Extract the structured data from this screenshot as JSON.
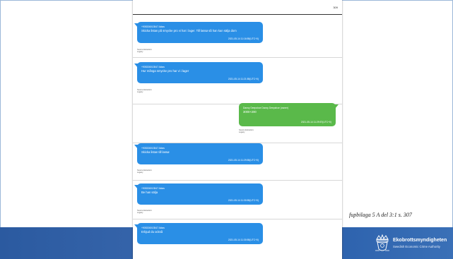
{
  "page": {
    "number": "309"
  },
  "messages": [
    {
      "sender": "+905336013547 Aktas",
      "body": "Skicka listan på smycke pro vi har i lager. Till lassø så han kan sälja dom",
      "timestamp": "2021-05-14 11:16:55(UTC+0)",
      "meta": [
        "Source Extraction:",
        "Legacy"
      ]
    },
    {
      "sender": "+905336013547 Aktas",
      "body": "Hur många smycke pro har vi i lager",
      "timestamp": "2021-05-14 11:21:55(UTC+0)",
      "meta": [
        "Source Extraction:",
        "Legacy"
      ]
    },
    {
      "sender": "Danny Deepshoe Danny Deepshoe (owner)",
      "body": "3000+200",
      "timestamp": "2021-05-14 11:29:57(UTC+0)",
      "meta": [
        "Source Extraction:",
        "Legacy"
      ]
    },
    {
      "sender": "+905336013547 Aktas",
      "body": "Skicka listan till lassø",
      "timestamp": "2021-05-14 11:29:55(UTC+0)",
      "meta": [
        "Source Extraction:",
        "Legacy"
      ]
    },
    {
      "sender": "+905336013547 Aktas",
      "body": "Be han sälja",
      "timestamp": "2021-05-14 11:30:55(UTC+0)",
      "meta": [
        "Source Extraction:",
        "Legacy"
      ]
    },
    {
      "sender": "+905336013547 Aktas",
      "body": "Erbjud du också",
      "timestamp": "2021-05-14 11:30:55(UTC+0)",
      "meta": []
    }
  ],
  "caption": "fupbilaga 5 A del 3:1 s. 307",
  "logo": {
    "name": "Ekobrottsmyndigheten",
    "subtitle": "Swedish Economic Crime Authority",
    "icon": "crown-emblem-icon"
  },
  "colors": {
    "incoming_bubble": "#2a8fe6",
    "outgoing_bubble": "#5ab94a",
    "footer_band": "#2f62a8"
  }
}
